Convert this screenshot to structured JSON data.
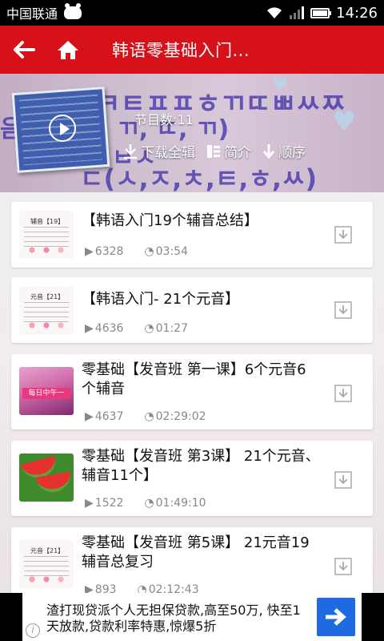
{
  "status_bar": {
    "carrier": "中国联通",
    "time": "14:26"
  },
  "title_bar": {
    "title": "韩语零基础入门...",
    "back_icon": "back-arrow-icon",
    "home_icon": "home-icon",
    "color": "#d7111a"
  },
  "header": {
    "background_text": [
      "ㅎㅋㅌㅍㅍㅎㄲㄸㅃㅆㅉ",
      "음",
      "ㄲ, ㄸ, ㄲ)",
      "ㅂㅅ",
      "ㄷ(ㅅ,ㅈ,ㅊ,ㅌ,ㅎ,ㅆ)"
    ],
    "program_count": "节目数:11",
    "actions": [
      {
        "label": "下载全辑",
        "icon": "download-icon"
      },
      {
        "label": "简介",
        "icon": "intro-icon"
      },
      {
        "label": "顺序",
        "icon": "sort-down-icon"
      }
    ]
  },
  "episodes": [
    {
      "title": "【韩语入门19个辅音总结】",
      "plays": "6328",
      "duration": "03:54",
      "thumb": "doc",
      "thumb_label": "辅音【19】"
    },
    {
      "title": "【韩语入门- 21个元音】",
      "plays": "4636",
      "duration": "01:27",
      "thumb": "doc",
      "thumb_label": "元音【21】"
    },
    {
      "title": "零基础【发音班 第一课】6个元音6个辅音",
      "plays": "4637",
      "duration": "02:29:02",
      "thumb": "pink",
      "thumb_label": "每日中午一"
    },
    {
      "title": "零基础【发音班 第3课】 21个元音、辅音11个】",
      "plays": "1522",
      "duration": "01:49:10",
      "thumb": "melon",
      "thumb_label": ""
    },
    {
      "title": "零基础【发音班 第5课】 21元音19辅音总复习",
      "plays": "893",
      "duration": "02:12:43",
      "thumb": "doc",
      "thumb_label": "元音【21】"
    }
  ],
  "ad": {
    "text": "渣打现贷派个人无担保贷款,高至50万, 快至1天放款,贷款利率特惠,惊爆5折",
    "info": "i",
    "button_color": "#1e6ae0"
  }
}
